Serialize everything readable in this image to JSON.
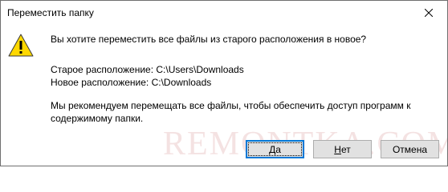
{
  "window": {
    "title": "Переместить папку",
    "close_icon": "close-icon"
  },
  "message": {
    "icon": "warning-icon",
    "question": "Вы хотите переместить все файлы из старого расположения в новое?",
    "old_location": "Старое расположение: C:\\Users\\Downloads",
    "new_location": "Новое расположение: C:\\Downloads",
    "recommendation_line1": "Мы рекомендуем перемещать все файлы, чтобы обеспечить доступ программ к",
    "recommendation_line2": "содержимому папки."
  },
  "watermark": "REMONTKA.COM",
  "buttons": {
    "yes": {
      "label_underlined": "Д",
      "label_rest": "а"
    },
    "no": {
      "label_underlined": "Н",
      "label_rest": "ет"
    },
    "cancel": {
      "label": "Отмена"
    }
  },
  "colors": {
    "default_button_border": "#0078d7",
    "warning_fill": "#ffd800",
    "button_face": "#e1e1e1"
  }
}
